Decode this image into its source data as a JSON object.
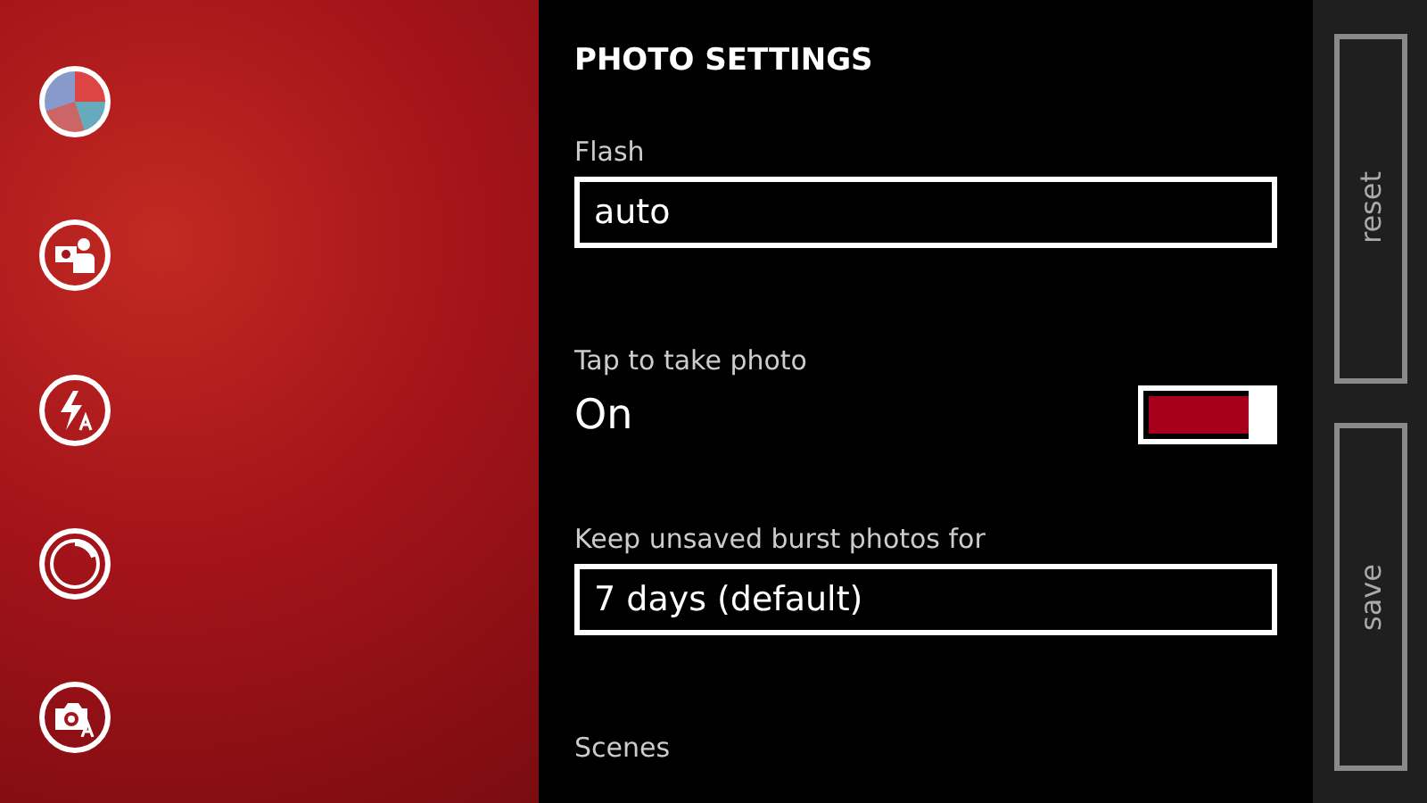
{
  "title": "PHOTO SETTINGS",
  "settings": [
    {
      "kind": "dropdown",
      "label": "Flash",
      "value": "auto"
    },
    {
      "kind": "toggle",
      "label": "Tap to take photo",
      "value": "On",
      "on": true
    },
    {
      "kind": "dropdown",
      "label": "Keep unsaved burst photos for",
      "value": "7 days (default)"
    },
    {
      "kind": "heading",
      "label": "Scenes"
    }
  ],
  "buttons": [
    "reset",
    "save"
  ]
}
